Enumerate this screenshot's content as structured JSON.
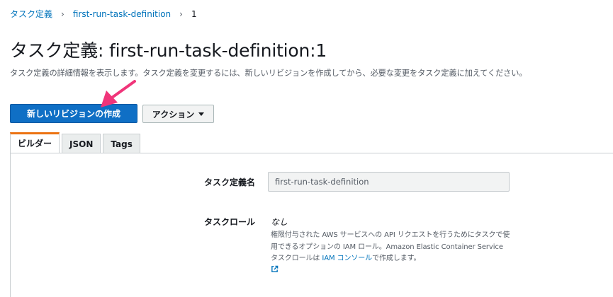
{
  "breadcrumb": {
    "items": [
      "タスク定義",
      "first-run-task-definition"
    ],
    "current": "1"
  },
  "page": {
    "title": "タスク定義: first-run-task-definition:1",
    "description": "タスク定義の詳細情報を表示します。タスク定義を変更するには、新しいリビジョンを作成してから、必要な変更をタスク定義に加えてください。"
  },
  "toolbar": {
    "create_revision_label": "新しいリビジョンの作成",
    "actions_label": "アクション"
  },
  "tabs": [
    {
      "label": "ビルダー",
      "active": true
    },
    {
      "label": "JSON",
      "active": false
    },
    {
      "label": "Tags",
      "active": false
    }
  ],
  "fields": {
    "task_definition_name": {
      "label": "タスク定義名",
      "value": "first-run-task-definition"
    },
    "task_role": {
      "label": "タスクロール",
      "value": "なし",
      "help_prefix": "権限付与された AWS サービスへの API リクエストを行うためにタスクで使用できるオプションの IAM ロール。Amazon Elastic Container Service タスクロールは ",
      "help_link": "IAM コンソール",
      "help_suffix": "で作成します。"
    }
  },
  "colors": {
    "link": "#0073bb",
    "primary_button": "#0f6fc5",
    "active_tab_accent": "#ec7211",
    "annotation_arrow": "#f0357a"
  },
  "icons": {
    "breadcrumb_separator": "chevron-right-icon",
    "actions_caret": "caret-down-icon",
    "help_external": "external-link-icon"
  }
}
